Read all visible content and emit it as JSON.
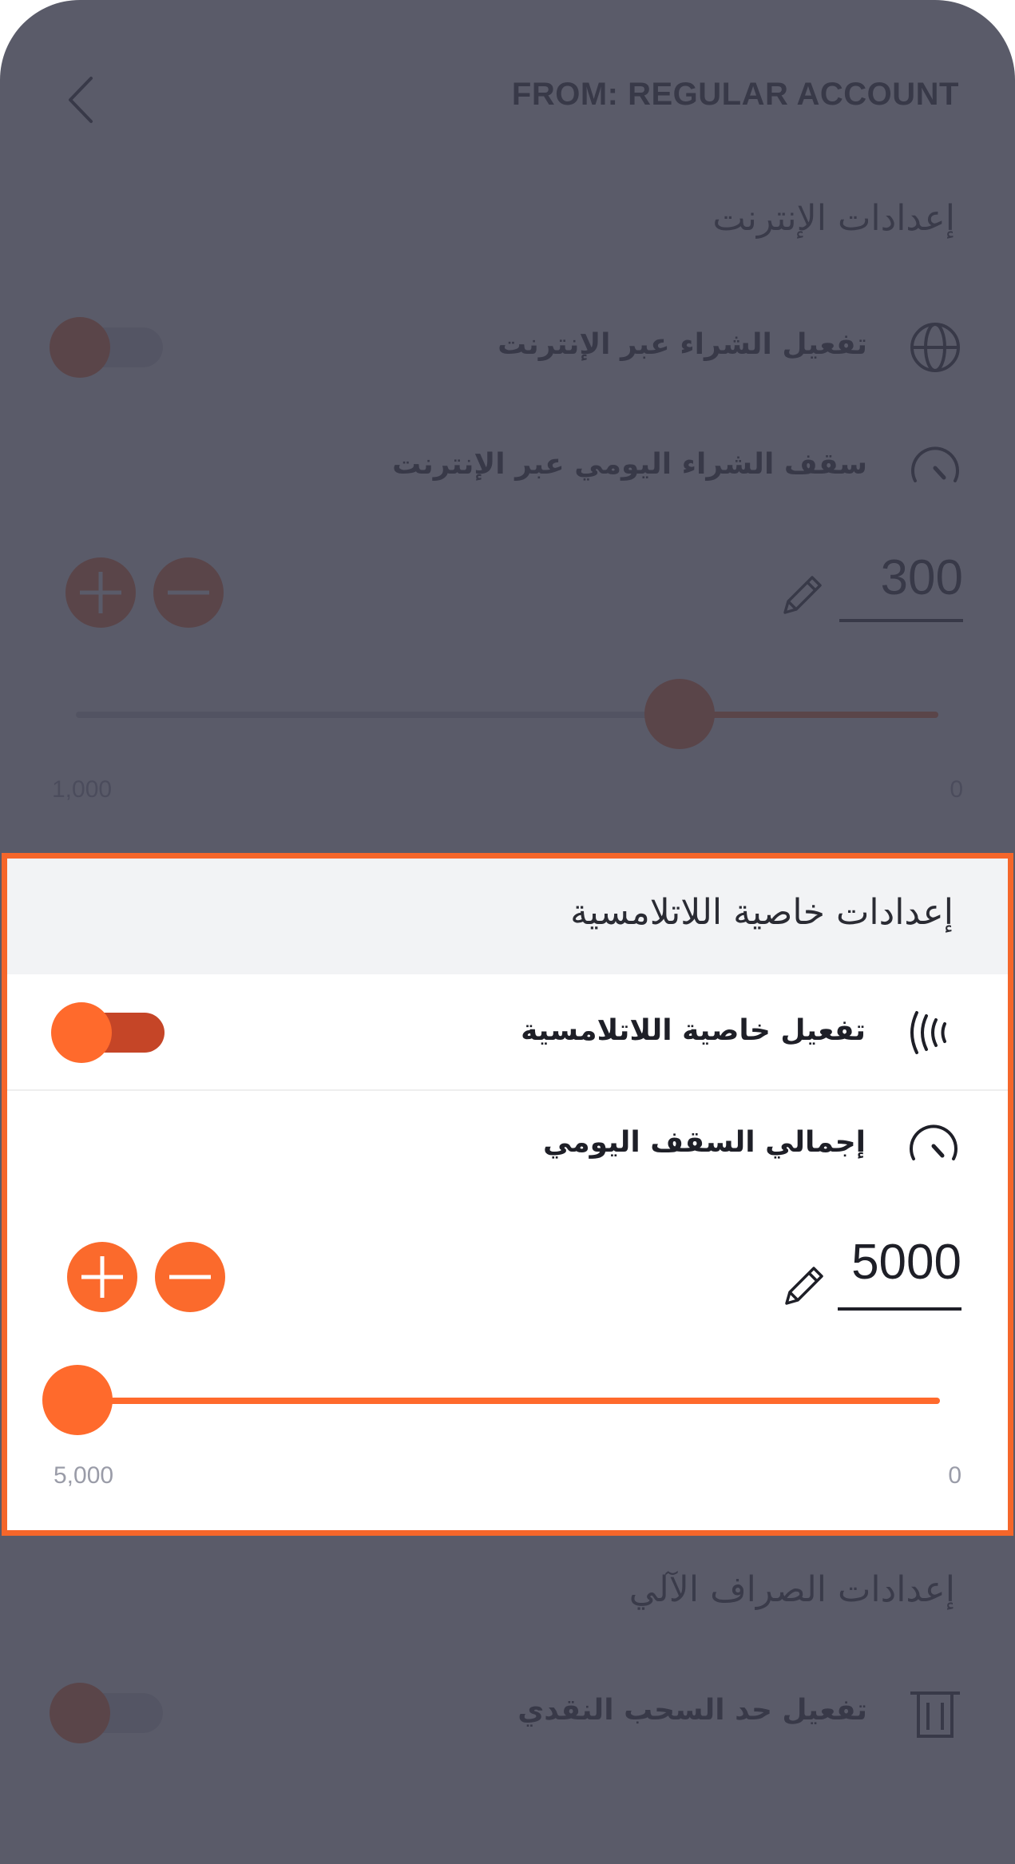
{
  "header": {
    "account_title": "FROM: REGULAR ACCOUNT"
  },
  "internet_section": {
    "title": "إعدادات الإنترنت",
    "enable_label": "تفعيل الشراء عبر الإنترنت",
    "enable_on": false,
    "limit_label": "سقف الشراء اليومي عبر الإنترنت",
    "amount": "300",
    "slider_value": 300,
    "range_max_label": "1,000",
    "range_min_label": "0"
  },
  "contactless_section": {
    "title": "إعدادات خاصية اللاتلامسية",
    "enable_label": "تفعيل خاصية اللاتلامسية",
    "enable_on": true,
    "limit_label": "إجمالي السقف اليومي",
    "amount": "5000",
    "slider_value": 5000,
    "range_max_label": "5,000",
    "range_min_label": "0"
  },
  "atm_section": {
    "title": "إعدادات الصراف الآلي",
    "enable_label": "تفعيل حد السحب النقدي",
    "enable_on": false
  },
  "colors": {
    "accent": "#ff6a2c",
    "highlight_border": "#f5662a",
    "toggle_track_on": "#c54527",
    "overlay": "#3d3e4f"
  },
  "icons": {
    "back": "chevron-left-icon",
    "internet": "globe-icon",
    "limit": "speedometer-icon",
    "contactless": "contactless-waves-icon",
    "atm": "atm-icon",
    "edit": "pencil-icon",
    "increase": "plus-icon",
    "decrease": "minus-icon"
  }
}
